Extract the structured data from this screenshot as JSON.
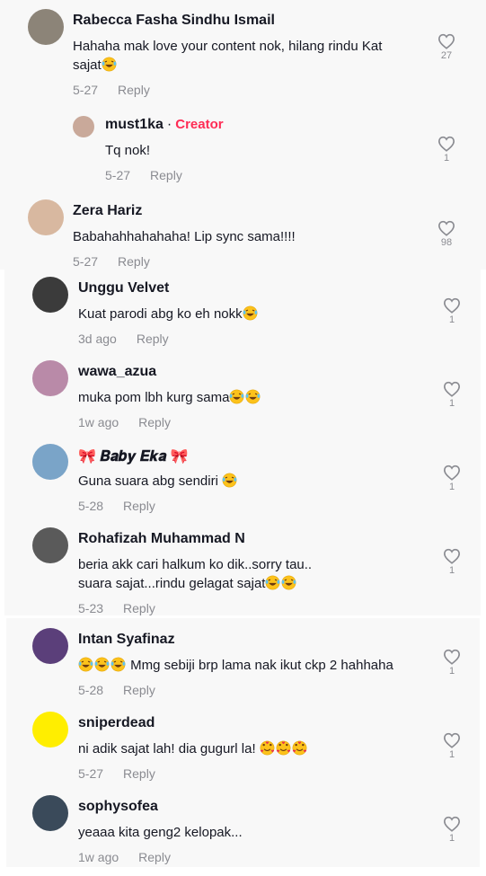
{
  "comments": [
    {
      "username": "Rabecca Fasha Sindhu Ismail",
      "text_lines": [
        "Hahaha mak love your content nok, hilang rindu Kat",
        "sajat"
      ],
      "emoji_after_last_line": [
        "laugh"
      ],
      "time": "5-27",
      "reply_label": "Reply",
      "likes": "27",
      "avatar_color": "#8c8478",
      "replies": [
        {
          "username": "must1ka",
          "badge": "Creator",
          "separator": "·",
          "text_lines": [
            "Tq nok!"
          ],
          "time": "5-27",
          "reply_label": "Reply",
          "likes": "1",
          "avatar_color": "#c9a99a"
        }
      ]
    },
    {
      "username": "Zera Hariz",
      "text_lines": [
        "Babahahhahahaha! Lip sync sama!!!!"
      ],
      "time": "5-27",
      "reply_label": "Reply",
      "likes": "98",
      "avatar_color": "#d8b8a0"
    },
    {
      "username": "Unggu Velvet",
      "text_lines": [
        "Kuat parodi abg ko eh nokk"
      ],
      "emoji_after_last_line": [
        "laugh"
      ],
      "time": "3d ago",
      "reply_label": "Reply",
      "likes": "1",
      "avatar_color": "#3b3b3b"
    },
    {
      "username": "wawa_azua",
      "text_lines": [
        "muka pom lbh kurg sama"
      ],
      "emoji_after_last_line": [
        "laugh",
        "laugh"
      ],
      "time": "1w ago",
      "reply_label": "Reply",
      "likes": "1",
      "avatar_color": "#b98aa8"
    },
    {
      "username": "🎀 𝑩𝒂𝒃𝒚 𝑬𝒌𝒂 🎀",
      "text_lines": [
        "Guna suara abg sendiri "
      ],
      "emoji_after_last_line": [
        "laugh"
      ],
      "time": "5-28",
      "reply_label": "Reply",
      "likes": "1",
      "avatar_color": "#7aa4c8"
    },
    {
      "username": "Rohafizah Muhammad N",
      "text_lines": [
        "beria akk cari halkum ko dik..sorry tau..",
        "suara sajat...rindu gelagat sajat"
      ],
      "emoji_after_last_line": [
        "laugh",
        "laugh"
      ],
      "time": "5-23",
      "reply_label": "Reply",
      "likes": "1",
      "avatar_color": "#5a5a5a"
    },
    {
      "username": "Intan Syafinaz",
      "text_lines": [
        " Mmg sebiji brp lama nak ikut ckp 2 hahhaha"
      ],
      "emoji_before_first_line": [
        "laugh",
        "laugh",
        "laugh"
      ],
      "time": "5-28",
      "reply_label": "Reply",
      "likes": "1",
      "avatar_color": "#5b3f7a"
    },
    {
      "username": "sniperdead",
      "text_lines": [
        "ni adik sajat lah! dia gugurl la! "
      ],
      "emoji_after_last_line": [
        "love",
        "love",
        "love"
      ],
      "time": "5-27",
      "reply_label": "Reply",
      "likes": "1",
      "avatar_color": "#ffee00"
    },
    {
      "username": "sophysofea",
      "text_lines": [
        "yeaaa kita geng2 kelopak..."
      ],
      "time": "1w ago",
      "reply_label": "Reply",
      "likes": "1",
      "avatar_color": "#3a4a5a"
    }
  ]
}
